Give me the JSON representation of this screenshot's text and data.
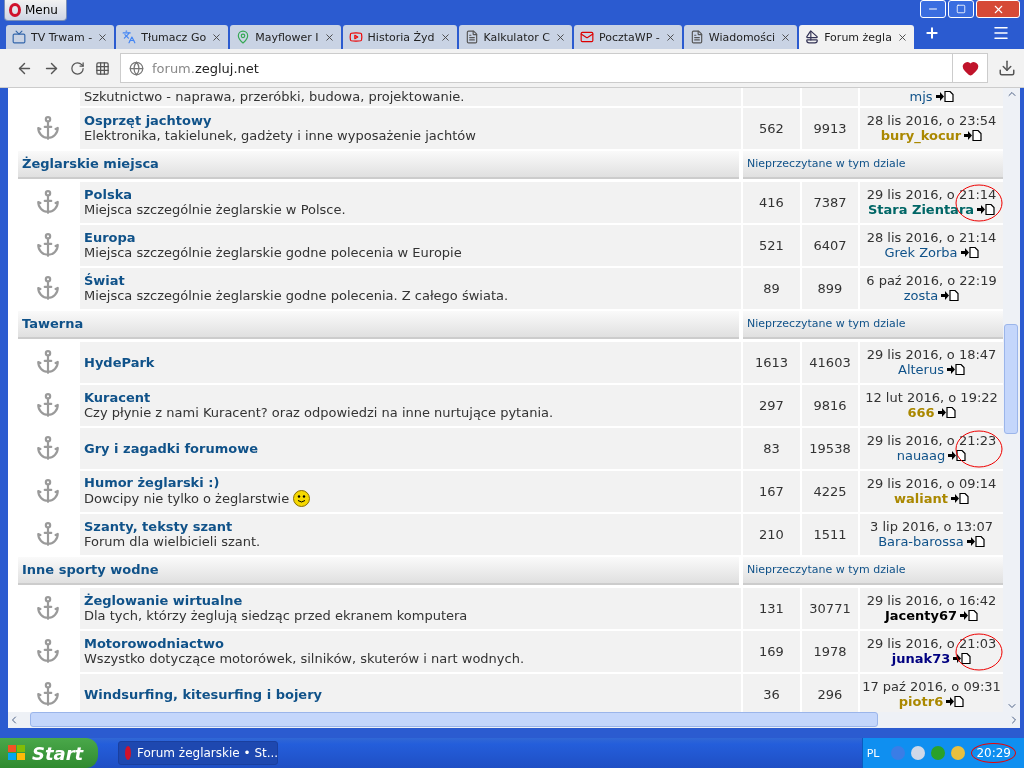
{
  "browser": {
    "menu_label": "Menu",
    "tabs": [
      {
        "label": "TV Trwam - ",
        "selected": false,
        "kind": "tv"
      },
      {
        "label": "Tłumacz Go",
        "selected": false,
        "kind": "translate"
      },
      {
        "label": "Mayflower I",
        "selected": false,
        "kind": "map"
      },
      {
        "label": "Historia Żyd",
        "selected": false,
        "kind": "video"
      },
      {
        "label": "Kalkulator C",
        "selected": false,
        "kind": "page"
      },
      {
        "label": "PocztaWP -",
        "selected": false,
        "kind": "mail"
      },
      {
        "label": "Wiadomości",
        "selected": false,
        "kind": "page"
      },
      {
        "label": "Forum żegla",
        "selected": true,
        "kind": "forum"
      }
    ],
    "address": {
      "domain_prefix": "forum.",
      "domain": "zegluj.net"
    }
  },
  "sections": [
    {
      "forums": [
        {
          "description": "Szkutnictwo - naprawa, przeróbki, budowa, projektowanie.",
          "last_user": {
            "name": "mjs",
            "color": "#105289",
            "bold": false
          },
          "highlighted": false
        },
        {
          "name": "Osprzęt jachtowy",
          "description": "Elektronika, takielunek, gadżety i inne wyposażenie jachtów",
          "topics": "562",
          "posts": "9913",
          "last_date": "28 lis 2016, o 23:54",
          "last_user": {
            "name": "bury_kocur",
            "color": "#aa8800",
            "bold": true
          },
          "highlighted": false
        }
      ]
    },
    {
      "title": "Żeglarskie miejsca",
      "unread_link": "Nieprzeczytane w tym dziale",
      "forums": [
        {
          "name": "Polska",
          "description": "Miejsca szczególnie żeglarskie w Polsce.",
          "topics": "416",
          "posts": "7387",
          "last_date": "29 lis 2016, o 21:14",
          "last_user": {
            "name": "Stara Zientara",
            "color": "#006666",
            "bold": true
          },
          "highlighted": true
        },
        {
          "name": "Europa",
          "description": "Miejsca szczególnie żeglarskie godne polecenia w Europie",
          "topics": "521",
          "posts": "6407",
          "last_date": "28 lis 2016, o 21:14",
          "last_user": {
            "name": "Grek Zorba",
            "color": "#105289",
            "bold": false
          },
          "highlighted": false
        },
        {
          "name": "Świat",
          "description": "Miejsca szczególnie żeglarskie godne polecenia. Z całego świata.",
          "topics": "89",
          "posts": "899",
          "last_date": "6 paź 2016, o 22:19",
          "last_user": {
            "name": "zosta",
            "color": "#105289",
            "bold": false
          },
          "highlighted": false
        }
      ]
    },
    {
      "title": "Tawerna",
      "unread_link": "Nieprzeczytane w tym dziale",
      "forums": [
        {
          "name": "HydePark",
          "topics": "1613",
          "posts": "41603",
          "last_date": "29 lis 2016, o 18:47",
          "last_user": {
            "name": "Alterus",
            "color": "#105289",
            "bold": false
          },
          "highlighted": false
        },
        {
          "name": "Kuracent",
          "description": "Czy płynie z nami Kuracent? oraz odpowiedzi na inne nurtujące pytania.",
          "topics": "297",
          "posts": "9816",
          "last_date": "12 lut 2016, o 19:22",
          "last_user": {
            "name": "666",
            "color": "#aa8800",
            "bold": true
          },
          "highlighted": false
        },
        {
          "name": "Gry i zagadki forumowe",
          "topics": "83",
          "posts": "19538",
          "last_date": "29 lis 2016, o 21:23",
          "last_user": {
            "name": "nauaag",
            "color": "#105289",
            "bold": false
          },
          "highlighted": true
        },
        {
          "name": "Humor żeglarski :)",
          "description": "Dowcipy nie tylko o żeglarstwie",
          "emoticon": true,
          "topics": "167",
          "posts": "4225",
          "last_date": "29 lis 2016, o 09:14",
          "last_user": {
            "name": "waliant",
            "color": "#aa8800",
            "bold": true
          },
          "highlighted": false
        },
        {
          "name": "Szanty, teksty szant",
          "description": "Forum dla wielbicieli szant.",
          "topics": "210",
          "posts": "1511",
          "last_date": "3 lip 2016, o 13:07",
          "last_user": {
            "name": "Bara-barossa",
            "color": "#105289",
            "bold": false
          },
          "highlighted": false
        }
      ]
    },
    {
      "title": "Inne sporty wodne",
      "unread_link": "Nieprzeczytane w tym dziale",
      "forums": [
        {
          "name": "Żeglowanie wirtualne",
          "description": "Dla tych, którzy żeglują siedząc przed ekranem komputera",
          "topics": "131",
          "posts": "30771",
          "last_date": "29 lis 2016, o 16:42",
          "last_user": {
            "name": "Jacenty67",
            "color": "#000000",
            "bold": true
          },
          "highlighted": false
        },
        {
          "name": "Motorowodniactwo",
          "description": "Wszystko dotyczące motorówek, silników, skuterów i nart wodnych.",
          "topics": "169",
          "posts": "1978",
          "last_date": "29 lis 2016, o 21:03",
          "last_user": {
            "name": "junak73",
            "color": "#000080",
            "bold": true
          },
          "highlighted": true
        },
        {
          "name": "Windsurfing, kitesurfing i bojery",
          "topics": "36",
          "posts": "296",
          "last_date": "17 paź 2016, o 09:31",
          "last_user": {
            "name": "piotr6",
            "color": "#aa8800",
            "bold": true
          },
          "highlighted": false
        }
      ]
    }
  ],
  "taskbar": {
    "start_label": "Start",
    "tasks": [
      {
        "label": "Forum żeglarskie • St...",
        "selected": true
      }
    ],
    "language": "PL",
    "clock": "20:29",
    "clock_highlighted": true
  }
}
